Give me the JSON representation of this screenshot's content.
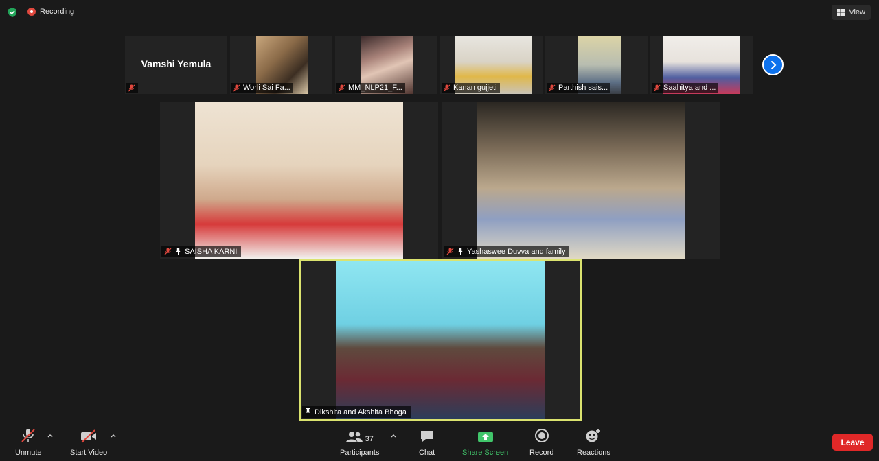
{
  "topbar": {
    "recording_label": "Recording",
    "view_label": "View",
    "shield_icon": "shield-check-icon"
  },
  "strip": {
    "tiles": [
      {
        "name": "Vamshi Yemula",
        "label": "",
        "muted": true
      },
      {
        "name": "",
        "label": "Worli Sai Fa...",
        "muted": true
      },
      {
        "name": "",
        "label": "MM_NLP21_F...",
        "muted": true
      },
      {
        "name": "",
        "label": "Kanan gujjeti",
        "muted": true
      },
      {
        "name": "",
        "label": "Parthish sais...",
        "muted": true
      },
      {
        "name": "",
        "label": "Saahitya and ...",
        "muted": true
      }
    ],
    "next_icon": "chevron-right-icon"
  },
  "tiles": {
    "saisha": {
      "label": "SAISHA KARNI",
      "muted": true,
      "pinned": true
    },
    "yashaswee": {
      "label": "Yashaswee Duvva and family",
      "muted": true,
      "pinned": true
    },
    "dikshita": {
      "label": "Dikshita and Akshita  Bhoga",
      "muted": false,
      "pinned": true,
      "active_speaker": true
    }
  },
  "toolbar": {
    "unmute": "Unmute",
    "start_video": "Start Video",
    "participants": "Participants",
    "participants_count": "37",
    "chat": "Chat",
    "share_screen": "Share Screen",
    "record": "Record",
    "reactions": "Reactions",
    "leave": "Leave"
  },
  "colors": {
    "background": "#1a1a1a",
    "tile": "#232323",
    "accent_blue": "#0e72ed",
    "share_green": "#41c66b",
    "leave_red": "#e02828",
    "active_speaker_border": "#dbe36f",
    "muted_red": "#e0483e"
  }
}
